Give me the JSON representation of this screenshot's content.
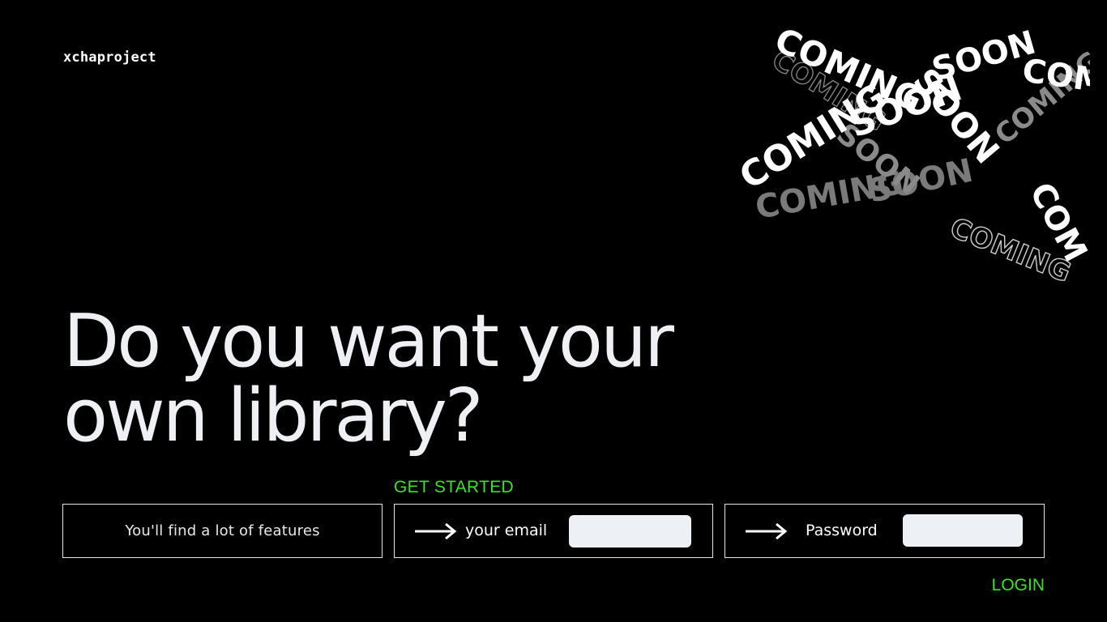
{
  "brand": {
    "name": "xchaproject"
  },
  "hero": {
    "line1": "Do you want your",
    "line2": "own library?"
  },
  "features": {
    "text": "You'll find a lot of features"
  },
  "cta": {
    "get_started": "GET STARTED",
    "login": "LOGIN"
  },
  "email": {
    "label": "your email",
    "value": "",
    "arrow_icon": "arrow-right-icon"
  },
  "password": {
    "label": "Password",
    "value": "",
    "arrow_icon": "arrow-right-icon"
  },
  "graphic": {
    "word1": "COMING",
    "word2": "SOON",
    "word3": "COM"
  },
  "colors": {
    "background": "#000000",
    "text": "#eef0f4",
    "accent": "#39e61e",
    "input_bg": "#edf0f4"
  }
}
